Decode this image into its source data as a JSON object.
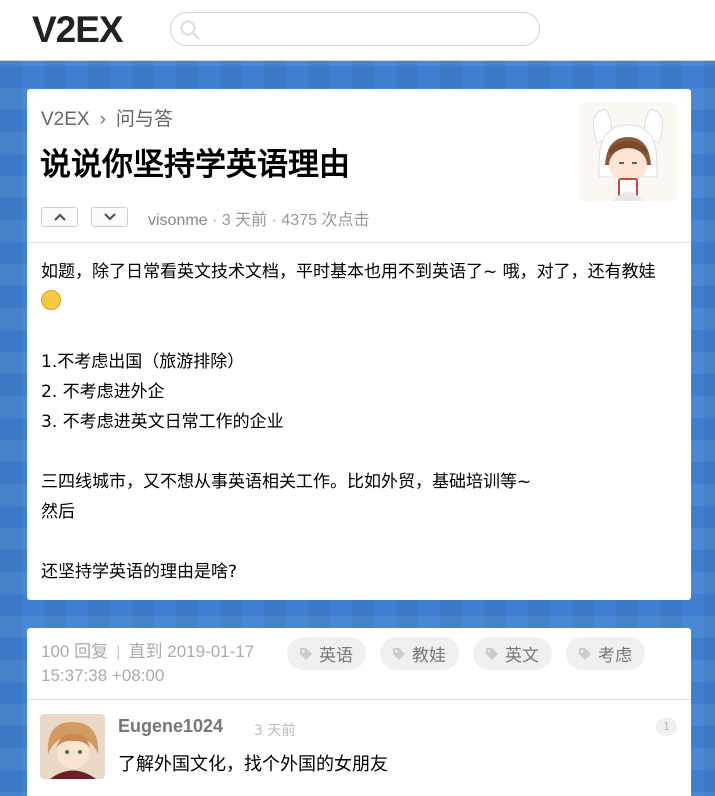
{
  "header": {
    "logo": "V2EX",
    "search_placeholder": ""
  },
  "topic": {
    "breadcrumb": {
      "home": "V2EX",
      "separator": "›",
      "node": "问与答"
    },
    "title": "说说你坚持学英语理由",
    "author": "visonme",
    "time": "3 天前",
    "clicks": "4375 次点击",
    "meta_sep": "·",
    "content": {
      "line1": "如题，除了日常看英文技术文档，平时基本也用不到英语了~ 哦，对了，还有教娃",
      "list1": "1.不考虑出国（旅游排除）",
      "list2": "2. 不考虑进外企",
      "list3": "3. 不考虑进英文日常工作的企业",
      "para2": "三四线城市，又不想从事英语相关工作。比如外贸，基础培训等~",
      "para2b": "然后",
      "para3": "还坚持学英语的理由是啥?"
    }
  },
  "replies_header": {
    "count": "100 回复",
    "separator": "|",
    "until": "直到 2019-01-17 15:37:38 +08:00",
    "tags": [
      "英语",
      "教娃",
      "英文",
      "考虑"
    ]
  },
  "reply": {
    "user": "Eugene1024",
    "time": "3 天前",
    "number": "1",
    "text": "了解外国文化，找个外国的女朋友"
  },
  "colors": {
    "background": "#3f7fd2",
    "card": "#ffffff",
    "meta_text": "#999999"
  }
}
